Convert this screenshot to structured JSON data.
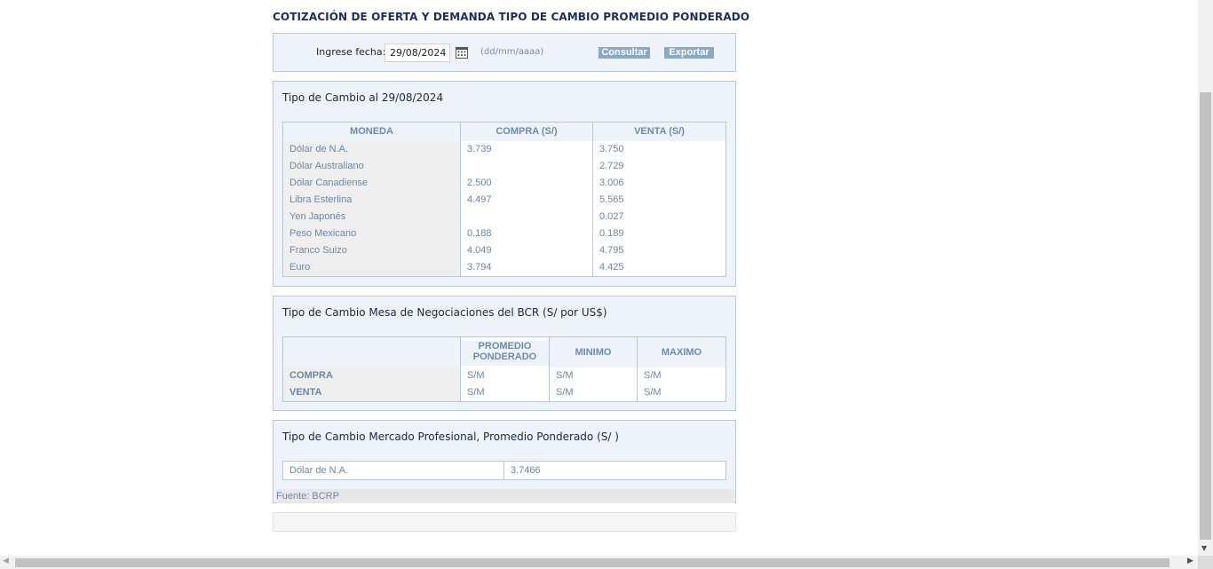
{
  "page": {
    "title": "COTIZACIÓN DE OFERTA Y DEMANDA TIPO DE CAMBIO PROMEDIO PONDERADO"
  },
  "form": {
    "date_label": "Ingrese fecha:",
    "date_value": "29/08/2024",
    "date_hint": "(dd/mm/aaaa)",
    "consultar_label": "Consultar",
    "exportar_label": "Exportar",
    "icon": "calendar-icon"
  },
  "exchange": {
    "title": "Tipo de Cambio al 29/08/2024",
    "headers": [
      "MONEDA",
      "COMPRA (S/)",
      "VENTA (S/)"
    ],
    "rows": [
      {
        "moneda": "Dólar de N.A.",
        "compra": "3.739",
        "venta": "3.750"
      },
      {
        "moneda": "Dólar Australiano",
        "compra": "",
        "venta": "2.729"
      },
      {
        "moneda": "Dólar Canadiense",
        "compra": "2.500",
        "venta": "3.006"
      },
      {
        "moneda": "Libra Esterlina",
        "compra": "4.497",
        "venta": "5.565"
      },
      {
        "moneda": "Yen Japonés",
        "compra": "",
        "venta": "0.027"
      },
      {
        "moneda": "Peso Mexicano",
        "compra": "0.188",
        "venta": "0.189"
      },
      {
        "moneda": "Franco Suizo",
        "compra": "4.049",
        "venta": "4.795"
      },
      {
        "moneda": "Euro",
        "compra": "3.794",
        "venta": "4.425"
      }
    ]
  },
  "mesa": {
    "title": "Tipo de Cambio Mesa de Negociaciones del BCR (S/ por US$)",
    "headers": [
      "",
      "PROMEDIO PONDERADO",
      "MINIMO",
      "MAXIMO"
    ],
    "rows": [
      {
        "label": "COMPRA",
        "promedio": "S/M",
        "minimo": "S/M",
        "maximo": "S/M"
      },
      {
        "label": "VENTA",
        "promedio": "S/M",
        "minimo": "S/M",
        "maximo": "S/M"
      }
    ]
  },
  "profesional": {
    "title": "Tipo de Cambio Mercado Profesional, Promedio Ponderado (S/ )",
    "row": {
      "label": "Dólar de N.A.",
      "value": "3.7466"
    },
    "source": "Fuente: BCRP"
  },
  "colors": {
    "title": "#1c2f5a",
    "panel_bg": "#eef3f9",
    "panel_border": "#b7c8da",
    "button_bg": "#8aa9c7",
    "cell_text": "#6c86a4"
  }
}
